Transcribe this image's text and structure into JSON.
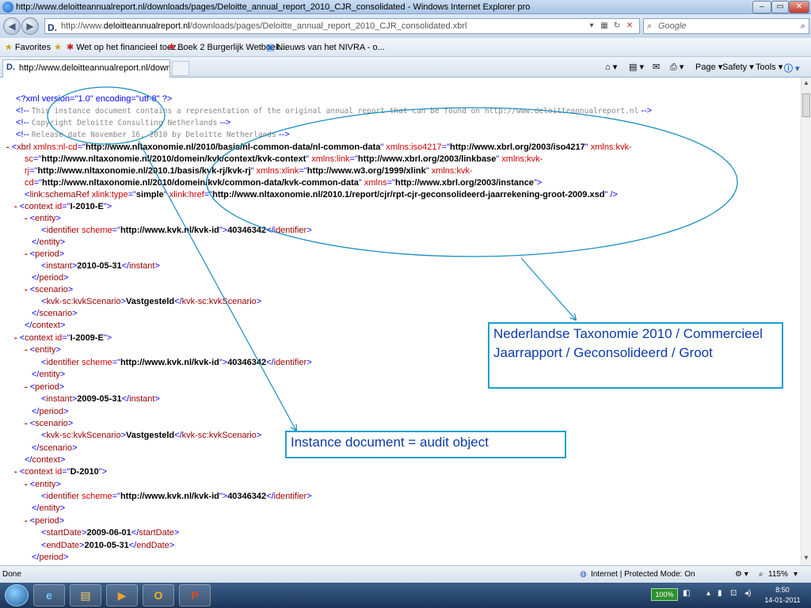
{
  "window": {
    "title": "http://www.deloitteannualreport.nl/downloads/pages/Deloitte_annual_report_2010_CJR_consolidated - Windows Internet Explorer pro",
    "minimize": "–",
    "maximize": "▭",
    "close": "✕"
  },
  "address": {
    "favicon": "D.",
    "url_prefix": "http://www.",
    "url_domain": "deloitteannualreport.nl",
    "url_path": "/downloads/pages/Deloitte_annual_report_2010_CJR_consolidated.xbrl",
    "search_placeholder": "Google"
  },
  "favorites": {
    "label": "Favorites",
    "items": [
      "Wet op het financieel toez...",
      "Boek 2 Burgerlijk Wetboek...",
      "Nieuws van het NIVRA - o..."
    ]
  },
  "tab": {
    "favicon": "D.",
    "title": "http://www.deloitteannualreport.nl/downloads/..."
  },
  "commands": {
    "page": "Page",
    "safety": "Safety",
    "tools": "Tools"
  },
  "xml": {
    "decl": "<?xml version=\"1.0\" encoding=\"utf-8\" ?>",
    "comment1": "This instance document contains a representation of the original annual report that can be found on http://www.deloitteannualreport.nl",
    "comment2": "Copyright Deloitte Consulting Netherlands",
    "comment3": "Release date November 16, 2010 by Deloitte Netherlands",
    "ns_nlcd": "http://www.nltaxonomie.nl/2010/basis/nl-common-data/nl-common-data",
    "ns_iso": "http://www.xbrl.org/2003/iso4217",
    "ns_kvksc": "http://www.nltaxonomie.nl/2010/domein/kvk/context/kvk-context",
    "ns_link": "http://www.xbrl.org/2003/linkbase",
    "ns_kvkrj": "http://www.nltaxonomie.nl/2010.1/basis/kvk-rj/kvk-rj",
    "ns_xlink": "http://www.w3.org/1999/xlink",
    "ns_kvkcd": "http://www.nltaxonomie.nl/2010/domein/kvk/common-data/kvk-common-data",
    "ns_xbrli": "http://www.xbrl.org/2003/instance",
    "schema_type": "simple",
    "schema_href": "http://www.nltaxonomie.nl/2010.1/report/cjr/rpt-cjr-geconsolideerd-jaarrekening-groot-2009.xsd",
    "ctx1_id": "I-2010-E",
    "ctx2_id": "I-2009-E",
    "ctx3_id": "D-2010",
    "scheme": "http://www.kvk.nl/kvk-id",
    "kvk_id": "40346342",
    "instant1": "2010-05-31",
    "instant2": "2009-05-31",
    "scenario": "Vastgesteld",
    "start_date": "2009-06-01",
    "end_date": "2010-05-31"
  },
  "callouts": {
    "taxonomy": "Nederlandse Taxonomie 2010 / Commercieel Jaarrapport / Geconsolideerd / Groot",
    "instance": "Instance document = audit object"
  },
  "status": {
    "text": "Done",
    "zone": "Internet | Protected Mode: On",
    "zoom": "115%"
  },
  "taskbar": {
    "battery": "100%",
    "time": "8:50",
    "date": "14-01-2011"
  },
  "colors": {
    "callout_border": "#1aa0d0",
    "callout_text": "#0b3aa8",
    "annotation": "#1a8fc0"
  }
}
